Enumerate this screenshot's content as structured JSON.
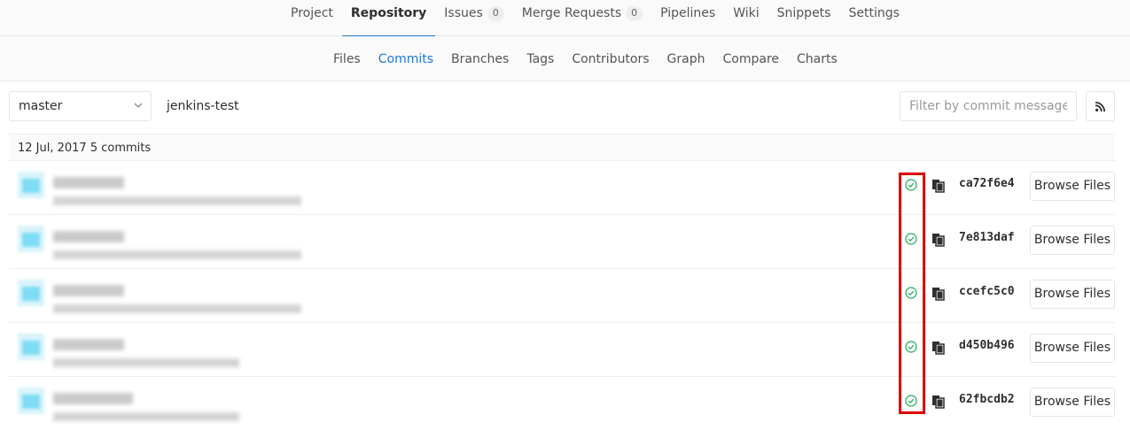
{
  "top_nav": {
    "tabs": [
      {
        "label": "Project"
      },
      {
        "label": "Repository",
        "active": true
      },
      {
        "label": "Issues",
        "count": "0"
      },
      {
        "label": "Merge Requests",
        "count": "0"
      },
      {
        "label": "Pipelines"
      },
      {
        "label": "Wiki"
      },
      {
        "label": "Snippets"
      },
      {
        "label": "Settings"
      }
    ]
  },
  "sub_nav": {
    "tabs": [
      {
        "label": "Files"
      },
      {
        "label": "Commits",
        "active": true
      },
      {
        "label": "Branches"
      },
      {
        "label": "Tags"
      },
      {
        "label": "Contributors"
      },
      {
        "label": "Graph"
      },
      {
        "label": "Compare"
      },
      {
        "label": "Charts"
      }
    ]
  },
  "toolbar": {
    "branch": "master",
    "path": "jenkins-test",
    "filter_placeholder": "Filter by commit message",
    "rss_icon": "rss-icon"
  },
  "day_header": "12 Jul, 2017 5 commits",
  "commits": [
    {
      "sha": "ca72f6e4",
      "status": "passed",
      "browse_label": "Browse Files"
    },
    {
      "sha": "7e813daf",
      "status": "passed",
      "browse_label": "Browse Files"
    },
    {
      "sha": "ccefc5c0",
      "status": "passed",
      "browse_label": "Browse Files"
    },
    {
      "sha": "d450b496",
      "status": "passed",
      "browse_label": "Browse Files"
    },
    {
      "sha": "62fbcdb2",
      "status": "passed",
      "browse_label": "Browse Files"
    }
  ],
  "colors": {
    "accent": "#1f78d1",
    "status_success": "#1aaa55",
    "highlight": "#e00000"
  }
}
